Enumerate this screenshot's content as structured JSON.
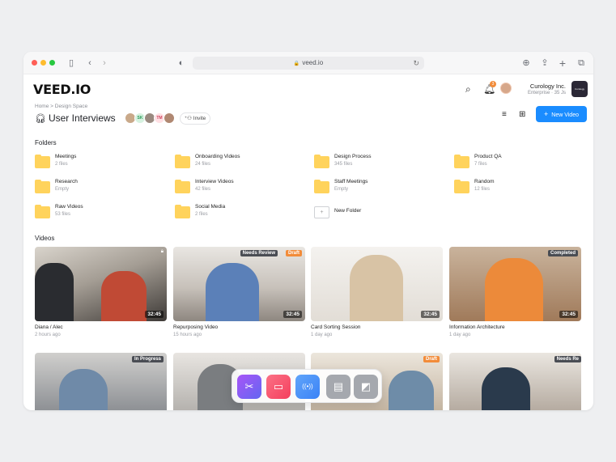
{
  "browser": {
    "url": "veed.io",
    "traffic_lights": [
      "#ff5f57",
      "#febc2e",
      "#28c840"
    ]
  },
  "app": {
    "logo": "VEED.IO",
    "notification_count": "3",
    "org_name": "Curology Inc.",
    "org_plan": "Enterprise · 35 Js",
    "org_logo_text": "Curology"
  },
  "page": {
    "breadcrumb": "Home  >  Design Space",
    "title": "User Interviews",
    "collaborators": [
      {
        "initials": "",
        "color": "#c9a98a"
      },
      {
        "initials": "SK",
        "color": "#d6f2e0",
        "text_color": "#2d9a5a"
      },
      {
        "initials": "",
        "color": "#9a8a80"
      },
      {
        "initials": "TM",
        "color": "#ffe0e4",
        "text_color": "#d0465f"
      },
      {
        "initials": "",
        "color": "#b08872"
      }
    ],
    "invite_label": "Invite",
    "new_video_label": "New Video",
    "accent": "#1a8cff"
  },
  "folders_label": "Folders",
  "folders": [
    {
      "name": "Meetings",
      "meta": "2 files"
    },
    {
      "name": "Onboarding Videos",
      "meta": "24 files"
    },
    {
      "name": "Design Process",
      "meta": "345 files"
    },
    {
      "name": "Product QA",
      "meta": "7 files"
    },
    {
      "name": "Research",
      "meta": "Empty"
    },
    {
      "name": "Interview Videos",
      "meta": "42 files"
    },
    {
      "name": "Staff Meetings",
      "meta": "Empty"
    },
    {
      "name": "Random",
      "meta": "12 files"
    },
    {
      "name": "Raw Videos",
      "meta": "53 files"
    },
    {
      "name": "Social Media",
      "meta": "2 files"
    }
  ],
  "new_folder_label": "New Folder",
  "videos_label": "Videos",
  "videos": [
    {
      "title": "Diana / Alec",
      "meta": "2 hours ago",
      "duration": "32:45",
      "badges": [],
      "bg": "#6d6a66"
    },
    {
      "title": "Repurposing Video",
      "meta": "15 hours ago",
      "duration": "32:45",
      "badges": [
        {
          "text": "Needs Review",
          "color": "#4a4d54"
        },
        {
          "text": "Draft",
          "color": "#f28c3a"
        }
      ],
      "bg": "#b7aea6"
    },
    {
      "title": "Card Sorting Session",
      "meta": "1 day ago",
      "duration": "32:45",
      "badges": [],
      "bg": "#e8e4df"
    },
    {
      "title": "Information Architecture",
      "meta": "1 day ago",
      "duration": "32:45",
      "badges": [
        {
          "text": "Completed",
          "color": "#4a4d54"
        }
      ],
      "bg": "#b98a6a"
    },
    {
      "title": "",
      "meta": "",
      "duration": "",
      "badges": [
        {
          "text": "In Progress",
          "color": "#4a4d54"
        }
      ],
      "bg": "#8c8f94"
    },
    {
      "title": "",
      "meta": "",
      "duration": "",
      "badges": [],
      "bg": "#9ea3a8"
    },
    {
      "title": "",
      "meta": "",
      "duration": "",
      "badges": [
        {
          "text": "Draft",
          "color": "#f28c3a"
        }
      ],
      "bg": "#cdbfae"
    },
    {
      "title": "",
      "meta": "",
      "duration": "",
      "badges": [
        {
          "text": "Needs Re",
          "color": "#4a4d54"
        }
      ],
      "bg": "#a89a8e"
    }
  ],
  "dock": [
    {
      "icon": "scissors-icon",
      "glyph": "✂",
      "color": "#8b5cf6"
    },
    {
      "icon": "record-icon",
      "glyph": "▭",
      "color": "#f43f5e"
    },
    {
      "icon": "broadcast-icon",
      "glyph": "((•))",
      "color": "#3b82f6"
    },
    {
      "icon": "layout-icon",
      "glyph": "▤",
      "color": "#9ca3af"
    },
    {
      "icon": "brand-kit-icon",
      "glyph": "◩",
      "color": "#9ca3af"
    }
  ]
}
